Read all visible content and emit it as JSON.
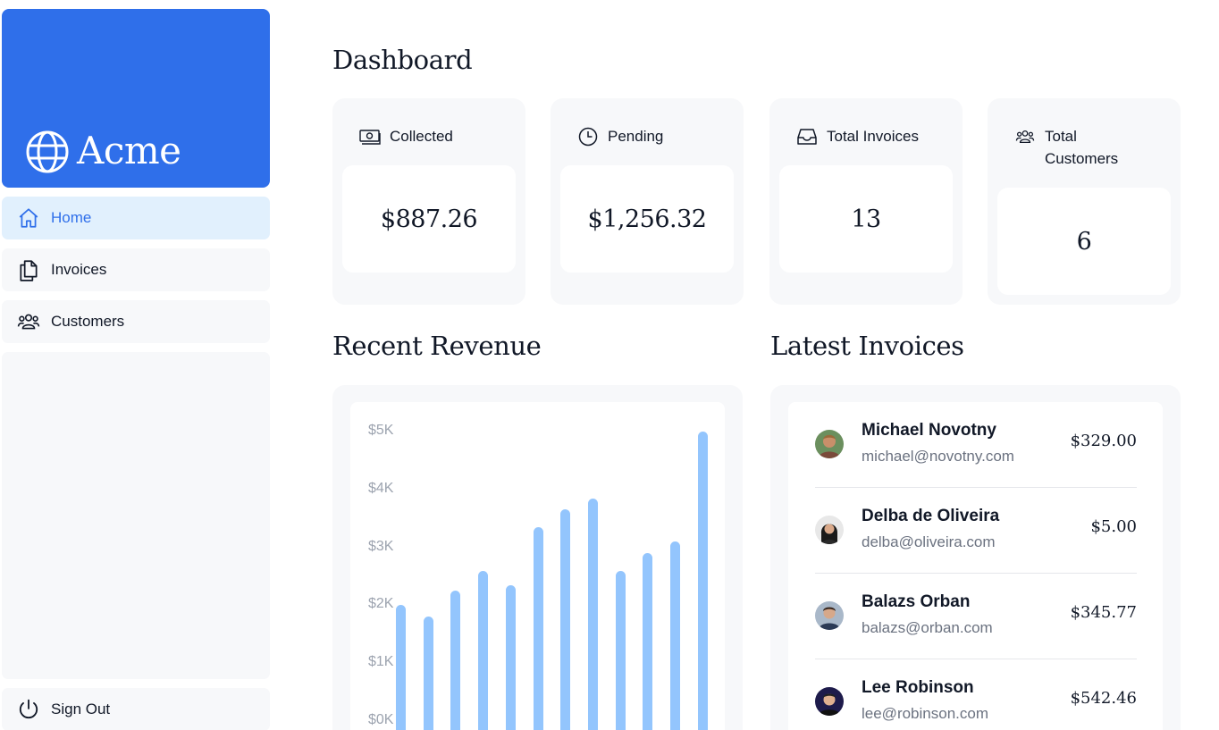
{
  "app": {
    "name": "Acme"
  },
  "sidebar": {
    "items": [
      {
        "label": "Home",
        "icon": "home-icon",
        "active": true
      },
      {
        "label": "Invoices",
        "icon": "documents-icon",
        "active": false
      },
      {
        "label": "Customers",
        "icon": "users-icon",
        "active": false
      }
    ],
    "sign_out": {
      "label": "Sign Out",
      "icon": "power-icon"
    }
  },
  "main": {
    "title": "Dashboard",
    "cards": [
      {
        "label": "Collected",
        "value": "$887.26",
        "icon": "banknotes-icon"
      },
      {
        "label": "Pending",
        "value": "$1,256.32",
        "icon": "clock-icon"
      },
      {
        "label": "Total Invoices",
        "value": "13",
        "icon": "inbox-icon"
      },
      {
        "label": "Total Customers",
        "value": "6",
        "icon": "user-group-icon"
      }
    ],
    "revenue": {
      "title": "Recent Revenue"
    },
    "latest_invoices": {
      "title": "Latest Invoices",
      "rows": [
        {
          "name": "Michael Novotny",
          "email": "michael@novotny.com",
          "amount": "$329.00"
        },
        {
          "name": "Delba de Oliveira",
          "email": "delba@oliveira.com",
          "amount": "$5.00"
        },
        {
          "name": "Balazs Orban",
          "email": "balazs@orban.com",
          "amount": "$345.77"
        },
        {
          "name": "Lee Robinson",
          "email": "lee@robinson.com",
          "amount": "$542.46"
        }
      ]
    }
  },
  "colors": {
    "accent": "#2f6fea",
    "bar": "#93c5fd",
    "panel": "#f7f8fa"
  },
  "chart_data": {
    "type": "bar",
    "yticks": [
      "$5K",
      "$4K",
      "$3K",
      "$2K",
      "$1K",
      "$0K"
    ],
    "ylim": [
      0,
      5000
    ],
    "values": [
      2000,
      1800,
      2250,
      2600,
      2350,
      3350,
      3650,
      3850,
      2600,
      2900,
      3100,
      5000
    ],
    "grid": false
  }
}
